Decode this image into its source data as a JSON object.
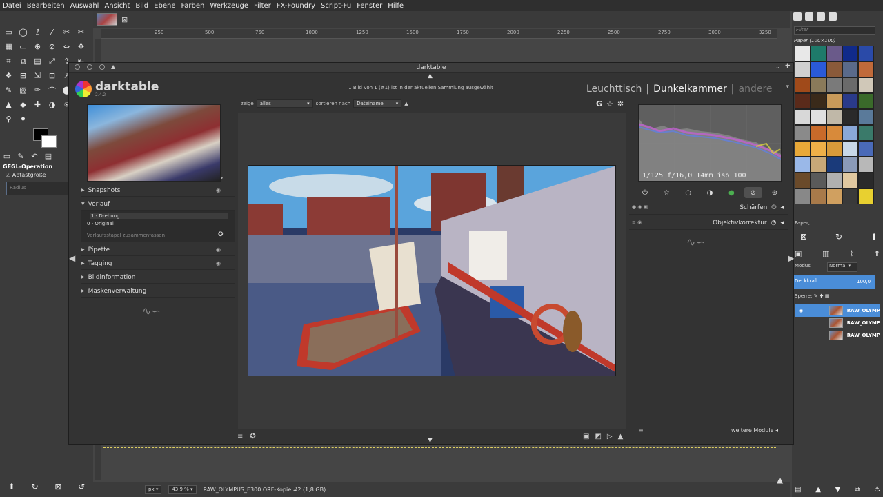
{
  "gimp": {
    "menu": [
      "Datei",
      "Bearbeiten",
      "Auswahl",
      "Ansicht",
      "Bild",
      "Ebene",
      "Farben",
      "Werkzeuge",
      "Filter",
      "FX-Foundry",
      "Script-Fu",
      "Fenster",
      "Hilfe"
    ],
    "tools": [
      "▭",
      "◯",
      "ℓ",
      "⁄",
      "✂",
      "✂",
      "▦",
      "▭",
      "⊕",
      "⊘",
      "⇔",
      "✥",
      "⌗",
      "⧉",
      "▤",
      "⤢",
      "⇪",
      "⇤",
      "❖",
      "⊞",
      "⇲",
      "⊡",
      "↗",
      "⋄",
      "✎",
      "▨",
      "✑",
      "⌒",
      "⬤",
      "⚗",
      "▲",
      "◆",
      "✚",
      "◑",
      "⍟",
      "✧",
      "⚲",
      "⚫"
    ],
    "tool_options": {
      "title": "GEGL-Operation",
      "sample_merged_label": "Abtastgröße",
      "radius_placeholder": "Radius"
    },
    "ruler_labels": [
      "250",
      "500",
      "750",
      "1000",
      "1250",
      "1500",
      "1750",
      "2000",
      "2250",
      "2500",
      "2750",
      "3000",
      "3250"
    ],
    "status": {
      "unit": "px",
      "zoom": "43,9 %",
      "filename": "RAW_OLYMPUS_E300.ORF-Kopie #2 (1,8 GB)"
    },
    "dock": {
      "filter_placeholder": "Filter",
      "pattern_title": "Paper (100×100)",
      "pattern_selected": "Paper,",
      "mode_label": "Modus",
      "mode_value": "Normal",
      "opacity_label": "Deckkraft",
      "opacity_value": "100,0",
      "lock_label": "Sperre:",
      "layers": [
        "RAW_OLYMP",
        "RAW_OLYMP",
        "RAW_OLYMP"
      ]
    }
  },
  "darktable": {
    "window_title": "darktable",
    "app_name": "darktable",
    "version": "2.4.2",
    "collection_status": "1 Bild von 1 (#1) ist in der aktuellen Sammlung ausgewählt",
    "views": {
      "lighttable": "Leuchttisch",
      "separator": "|",
      "darkroom": "Dunkelkammer",
      "other": "andere"
    },
    "filterbar": {
      "show_label": "zeige",
      "show_value": "alles",
      "sort_label": "sortieren nach",
      "sort_value": "Dateiname"
    },
    "left_sections": {
      "snapshots": "Snapshots",
      "history": "Verlauf",
      "pipette": "Pipette",
      "tagging": "Tagging",
      "image_info": "Bildinformation",
      "mask_manager": "Maskenverwaltung"
    },
    "history_items": [
      "1 - Drehung",
      "0 - Original"
    ],
    "history_compress": "Verlaufsstapel zusammenfassen",
    "exif": "1/125 f/16,0 14mm iso 100",
    "modules": [
      "Schärfen",
      "Objektivkorrektur"
    ],
    "more_modules": "weitere Module",
    "colors": {
      "accent": "#4a8dd8",
      "panel": "#333333"
    }
  }
}
